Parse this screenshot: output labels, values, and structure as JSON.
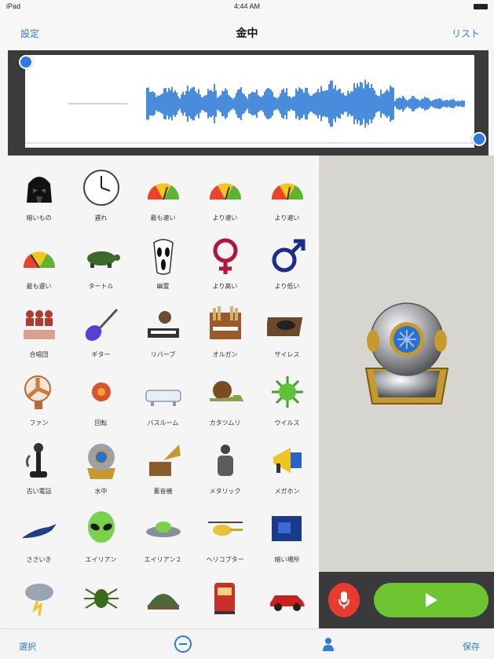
{
  "status_bar": {
    "left": "iPad",
    "time": "4:44 AM"
  },
  "nav": {
    "left_button": "設定",
    "title": "金中",
    "right_button": "リスト"
  },
  "grid": {
    "items": [
      {
        "icon": "darth-vader-icon",
        "label": "暗いもの"
      },
      {
        "icon": "clock-icon",
        "label": "遅れ"
      },
      {
        "icon": "speedometer-icon",
        "label": "最も速い"
      },
      {
        "icon": "speedometer-icon",
        "label": "より速い"
      },
      {
        "icon": "speedometer-icon",
        "label": "より速い"
      },
      {
        "icon": "speedometer-icon",
        "label": "最も遅い"
      },
      {
        "icon": "turtle-icon",
        "label": "タートル"
      },
      {
        "icon": "scream-mask-icon",
        "label": "幽霊"
      },
      {
        "icon": "female-symbol-icon",
        "label": "より高い"
      },
      {
        "icon": "male-symbol-icon",
        "label": "より低い"
      },
      {
        "icon": "choir-icon",
        "label": "合唱団"
      },
      {
        "icon": "guitar-icon",
        "label": "ギター"
      },
      {
        "icon": "piano-player-icon",
        "label": "リバーブ"
      },
      {
        "icon": "pipe-organ-icon",
        "label": "オルガン"
      },
      {
        "icon": "record-player-icon",
        "label": "サイレス"
      },
      {
        "icon": "fan-icon",
        "label": "ファン"
      },
      {
        "icon": "circle-blob-icon",
        "label": "回転"
      },
      {
        "icon": "bathtub-icon",
        "label": "バスルーム"
      },
      {
        "icon": "snail-icon",
        "label": "カタツムリ"
      },
      {
        "icon": "virus-icon",
        "label": "ウイルス"
      },
      {
        "icon": "candlestick-phone-icon",
        "label": "古い電話"
      },
      {
        "icon": "diving-helmet-icon",
        "label": "水中"
      },
      {
        "icon": "gramophone-icon",
        "label": "蓄音機"
      },
      {
        "icon": "robot-figure-icon",
        "label": "メタリック"
      },
      {
        "icon": "megaphone-icon",
        "label": "メガホン"
      },
      {
        "icon": "bird-icon",
        "label": "ささいき"
      },
      {
        "icon": "alien-head-icon",
        "label": "エイリアン"
      },
      {
        "icon": "ufo-icon",
        "label": "エイリアン２"
      },
      {
        "icon": "helicopter-icon",
        "label": "ヘリコプター"
      },
      {
        "icon": "dark-room-icon",
        "label": "暗い場所"
      },
      {
        "icon": "storm-cloud-icon",
        "label": ""
      },
      {
        "icon": "bug-icon",
        "label": ""
      },
      {
        "icon": "tortoise-icon",
        "label": ""
      },
      {
        "icon": "train-icon",
        "label": ""
      },
      {
        "icon": "car-icon",
        "label": ""
      }
    ]
  },
  "preview": {
    "icon": "diving-helmet-icon"
  },
  "controls": {
    "record": "microphone-icon",
    "play": "play-icon"
  },
  "bottom_bar": {
    "left": "選択",
    "center_icon": "minus-circle-icon",
    "person_icon": "person-icon",
    "right": "保存"
  },
  "colors": {
    "accent": "#2a7be4",
    "wave": "#1d6fd3",
    "record": "#e83a2e",
    "play": "#6cc531"
  }
}
